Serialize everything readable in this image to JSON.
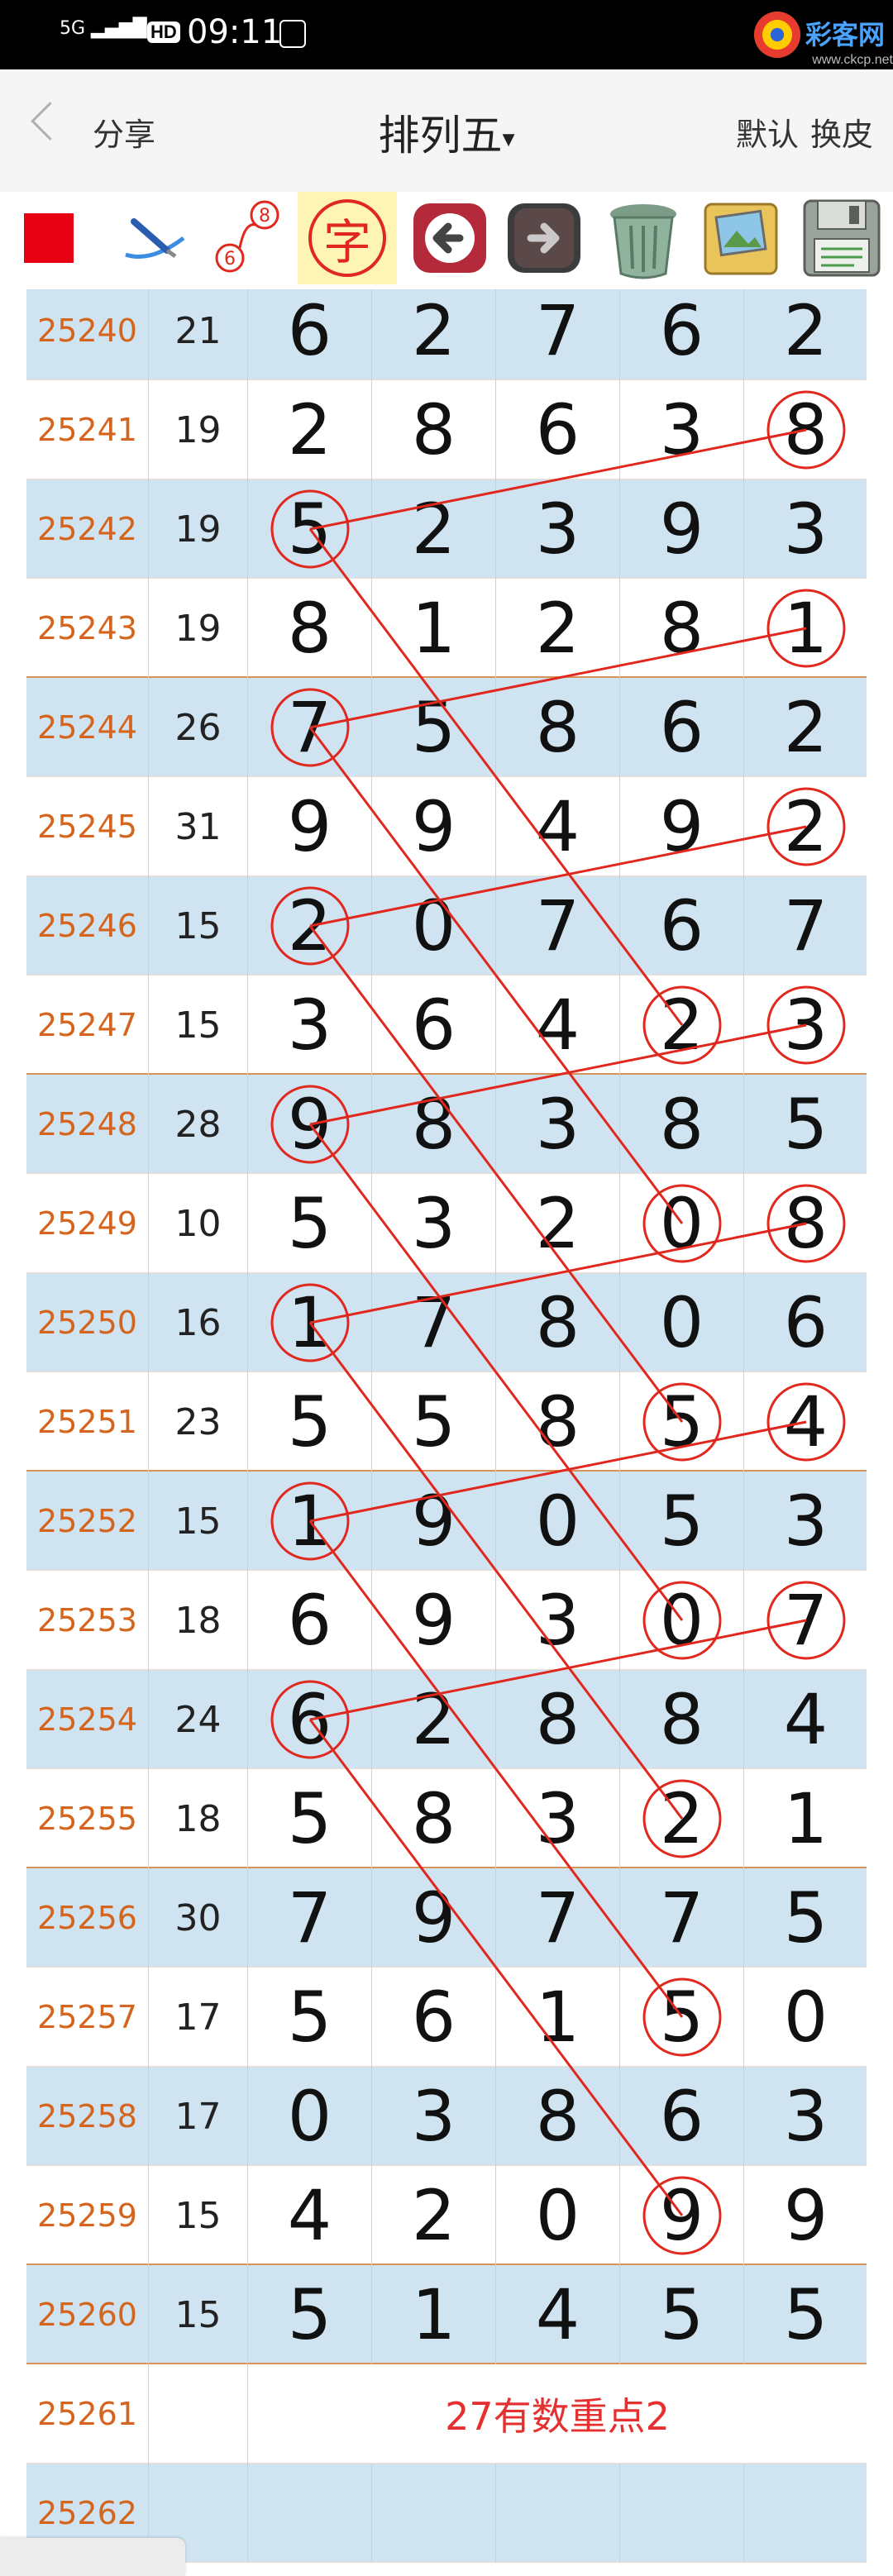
{
  "status": {
    "network": "5G",
    "hd": "HD",
    "time": "09:11",
    "logo_text": "彩客网",
    "logo_url": "www.ckcp.net"
  },
  "navbar": {
    "back_icon": "chevron-left-icon",
    "share_label": "分享",
    "title": "排列五",
    "title_arrow": "▾",
    "default_label": "默认",
    "skin_label": "换皮"
  },
  "toolbar": {
    "icons": [
      "red-square-icon",
      "pen-icon",
      "link-68-icon",
      "character-icon",
      "back-arrow-icon",
      "forward-arrow-icon",
      "trash-icon",
      "photo-album-icon",
      "floppy-disk-icon"
    ],
    "link_top": "8",
    "link_bottom": "6",
    "char_label": "字"
  },
  "colors": {
    "row_blue": "#cfe3f0",
    "row_white": "#ffffff",
    "issue_text": "#d4651e",
    "circle_line": "#e0281e",
    "note_text": "#e53030"
  },
  "rows": [
    {
      "issue": "25240",
      "sum": "21",
      "d": [
        "6",
        "2",
        "7",
        "6",
        "2"
      ]
    },
    {
      "issue": "25241",
      "sum": "19",
      "d": [
        "2",
        "8",
        "6",
        "3",
        "8"
      ]
    },
    {
      "issue": "25242",
      "sum": "19",
      "d": [
        "5",
        "2",
        "3",
        "9",
        "3"
      ]
    },
    {
      "issue": "25243",
      "sum": "19",
      "d": [
        "8",
        "1",
        "2",
        "8",
        "1"
      ]
    },
    {
      "issue": "25244",
      "sum": "26",
      "d": [
        "7",
        "5",
        "8",
        "6",
        "2"
      ]
    },
    {
      "issue": "25245",
      "sum": "31",
      "d": [
        "9",
        "9",
        "4",
        "9",
        "2"
      ]
    },
    {
      "issue": "25246",
      "sum": "15",
      "d": [
        "2",
        "0",
        "7",
        "6",
        "7"
      ]
    },
    {
      "issue": "25247",
      "sum": "15",
      "d": [
        "3",
        "6",
        "4",
        "2",
        "3"
      ]
    },
    {
      "issue": "25248",
      "sum": "28",
      "d": [
        "9",
        "8",
        "3",
        "8",
        "5"
      ]
    },
    {
      "issue": "25249",
      "sum": "10",
      "d": [
        "5",
        "3",
        "2",
        "0",
        "8"
      ]
    },
    {
      "issue": "25250",
      "sum": "16",
      "d": [
        "1",
        "7",
        "8",
        "0",
        "6"
      ]
    },
    {
      "issue": "25251",
      "sum": "23",
      "d": [
        "5",
        "5",
        "8",
        "5",
        "4"
      ]
    },
    {
      "issue": "25252",
      "sum": "15",
      "d": [
        "1",
        "9",
        "0",
        "5",
        "3"
      ]
    },
    {
      "issue": "25253",
      "sum": "18",
      "d": [
        "6",
        "9",
        "3",
        "0",
        "7"
      ]
    },
    {
      "issue": "25254",
      "sum": "24",
      "d": [
        "6",
        "2",
        "8",
        "8",
        "4"
      ]
    },
    {
      "issue": "25255",
      "sum": "18",
      "d": [
        "5",
        "8",
        "3",
        "2",
        "1"
      ]
    },
    {
      "issue": "25256",
      "sum": "30",
      "d": [
        "7",
        "9",
        "7",
        "7",
        "5"
      ]
    },
    {
      "issue": "25257",
      "sum": "17",
      "d": [
        "5",
        "6",
        "1",
        "5",
        "0"
      ]
    },
    {
      "issue": "25258",
      "sum": "17",
      "d": [
        "0",
        "3",
        "8",
        "6",
        "3"
      ]
    },
    {
      "issue": "25259",
      "sum": "15",
      "d": [
        "4",
        "2",
        "0",
        "9",
        "9"
      ]
    },
    {
      "issue": "25260",
      "sum": "15",
      "d": [
        "5",
        "1",
        "4",
        "5",
        "5"
      ]
    },
    {
      "issue": "25261",
      "sum": "",
      "d": [],
      "note": "27有数重点2"
    },
    {
      "issue": "25262",
      "sum": "",
      "d": []
    }
  ],
  "circles": [
    {
      "r": 1,
      "c": 4
    },
    {
      "r": 2,
      "c": 0
    },
    {
      "r": 3,
      "c": 4
    },
    {
      "r": 4,
      "c": 0
    },
    {
      "r": 5,
      "c": 4
    },
    {
      "r": 6,
      "c": 0
    },
    {
      "r": 7,
      "c": 3
    },
    {
      "r": 7,
      "c": 4
    },
    {
      "r": 8,
      "c": 0
    },
    {
      "r": 9,
      "c": 3
    },
    {
      "r": 9,
      "c": 4
    },
    {
      "r": 10,
      "c": 0
    },
    {
      "r": 11,
      "c": 3
    },
    {
      "r": 11,
      "c": 4
    },
    {
      "r": 12,
      "c": 0
    },
    {
      "r": 13,
      "c": 3
    },
    {
      "r": 13,
      "c": 4
    },
    {
      "r": 14,
      "c": 0
    },
    {
      "r": 15,
      "c": 3
    },
    {
      "r": 17,
      "c": 3
    },
    {
      "r": 19,
      "c": 3
    }
  ],
  "links": [
    [
      [
        1,
        4
      ],
      [
        2,
        0
      ]
    ],
    [
      [
        3,
        4
      ],
      [
        4,
        0
      ]
    ],
    [
      [
        5,
        4
      ],
      [
        6,
        0
      ]
    ],
    [
      [
        7,
        4
      ],
      [
        8,
        0
      ]
    ],
    [
      [
        9,
        4
      ],
      [
        10,
        0
      ]
    ],
    [
      [
        11,
        4
      ],
      [
        12,
        0
      ]
    ],
    [
      [
        13,
        4
      ],
      [
        14,
        0
      ]
    ],
    [
      [
        2,
        0
      ],
      [
        7,
        3
      ]
    ],
    [
      [
        4,
        0
      ],
      [
        9,
        3
      ]
    ],
    [
      [
        6,
        0
      ],
      [
        11,
        3
      ]
    ],
    [
      [
        8,
        0
      ],
      [
        13,
        3
      ]
    ],
    [
      [
        10,
        0
      ],
      [
        15,
        3
      ]
    ],
    [
      [
        12,
        0
      ],
      [
        17,
        3
      ]
    ],
    [
      [
        14,
        0
      ],
      [
        19,
        3
      ]
    ]
  ]
}
